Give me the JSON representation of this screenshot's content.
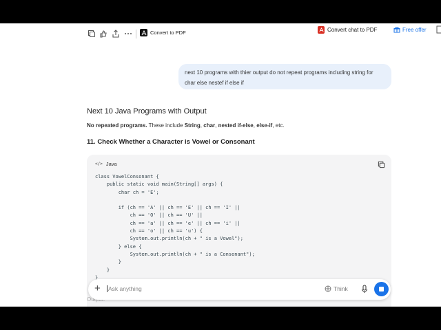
{
  "toolbar": {
    "convert_left_label": "Convert to PDF",
    "convert_right_label": "Convert chat to PDF",
    "free_offer_label": "Free offer",
    "icons": [
      "copy-icon",
      "like-dislike-icon",
      "share-icon",
      "more-icon",
      "pdf-icon"
    ],
    "accent": "#1a73e8",
    "pdf_red": "#d93025"
  },
  "user_message": "next 10 programs with thier output do not repeat programs including string for char else nestef if else if",
  "response": {
    "title": "Next 10 Java Programs with Output",
    "intro_bold": "No repeated programs.",
    "intro_mid": " These include ",
    "intro_items": [
      "String",
      "char",
      "nested if-else",
      "else-if"
    ],
    "intro_end": ", etc.",
    "heading": "11. Check Whether a Character is Vowel or Consonant",
    "code": {
      "language": "Java",
      "lines": [
        "class VowelConsonant {",
        "    public static void main(String[] args) {",
        "        char ch = 'E';",
        "",
        "        if (ch == 'A' || ch == 'E' || ch == 'I' ||",
        "            ch == 'O' || ch == 'U' ||",
        "            ch == 'a' || ch == 'e' || ch == 'i' ||",
        "            ch == 'o' || ch == 'u') {",
        "            System.out.println(ch + \" is a Vowel\");",
        "        } else {",
        "            System.out.println(ch + \" is a Consonant\");",
        "        }",
        "    }",
        "}"
      ]
    },
    "output_label": "Output:"
  },
  "composer": {
    "placeholder": "Ask anything",
    "think_label": "Think"
  }
}
